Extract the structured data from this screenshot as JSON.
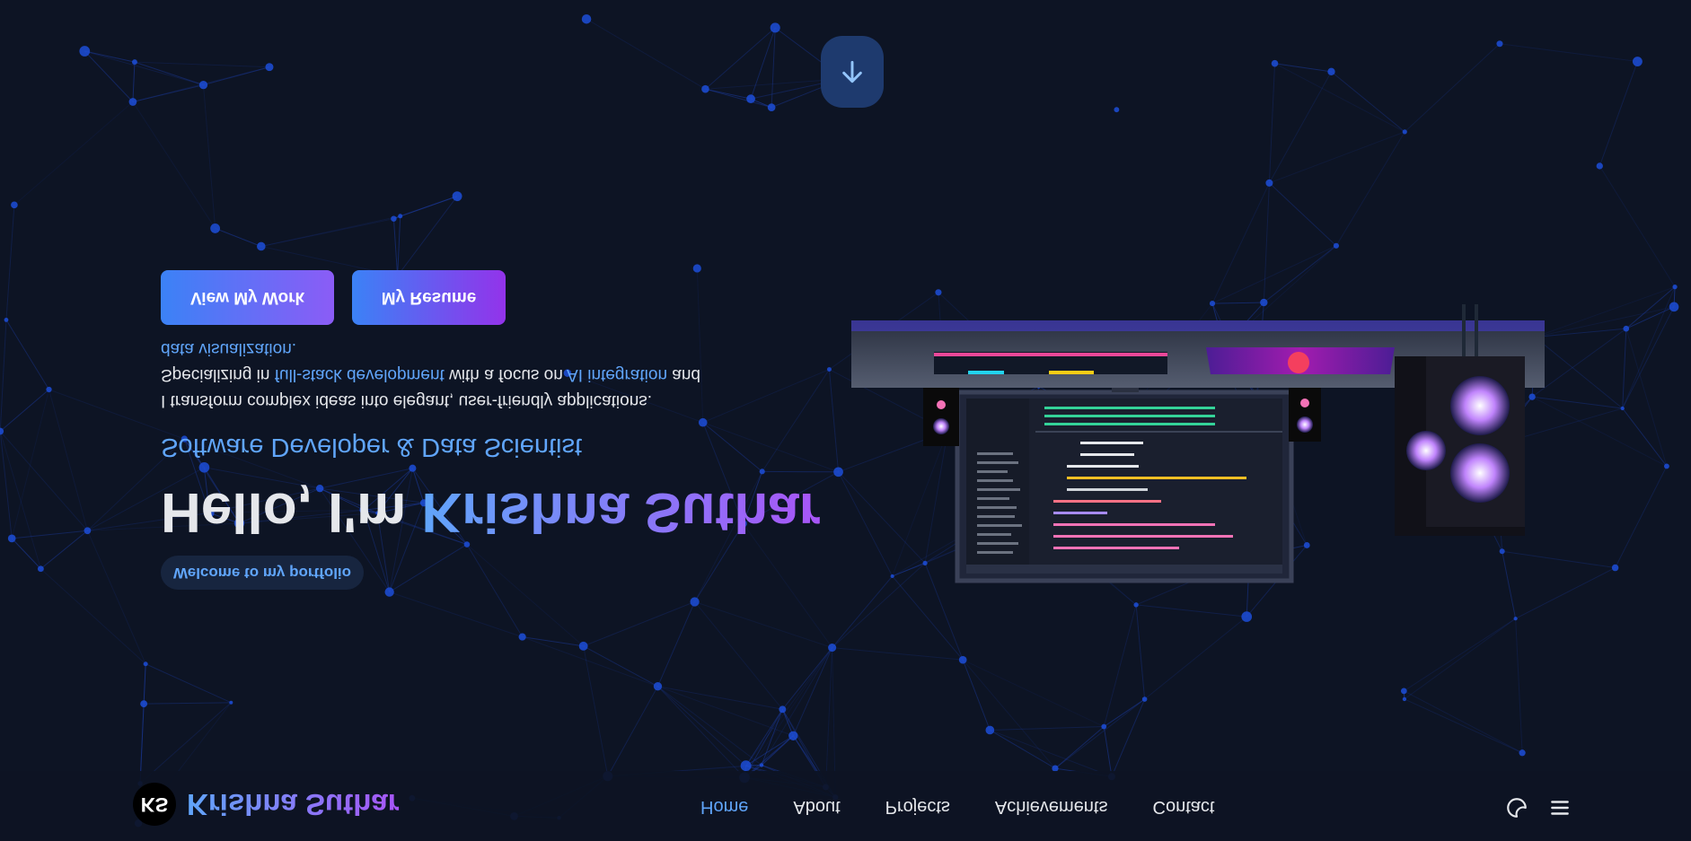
{
  "navbar": {
    "logo_initials": "KS",
    "logo_text": "Krishna Suthar",
    "links": [
      "Home",
      "About",
      "Projects",
      "Achievements",
      "Contact"
    ],
    "active_link": "Home",
    "icons": [
      "theme-toggle-icon",
      "menu-icon"
    ]
  },
  "hero": {
    "badge": "Welcome to my portfolio",
    "title_plain": "Hello, I'm ",
    "title_name": "Krishna Suthar",
    "subtitle": "Software Developer & Data Scientist",
    "desc_1": "I transform complex ideas into elegant, user-friendly applications.",
    "desc_2": "Specializing in ",
    "desc_hl_1": "full-stack development",
    "desc_3": " with a focus on ",
    "desc_hl_2": "AI integration",
    "desc_4": " and",
    "desc_5": "data visualization.",
    "btn_work": "View My Work",
    "btn_resume": "My Resume"
  },
  "scroll_top": {
    "icon": "arrow-up-icon"
  },
  "colors": {
    "background": "#0d1424",
    "accent_blue": "#60a5fa",
    "accent_purple": "#a855f7",
    "network_line": "#1e40af"
  }
}
